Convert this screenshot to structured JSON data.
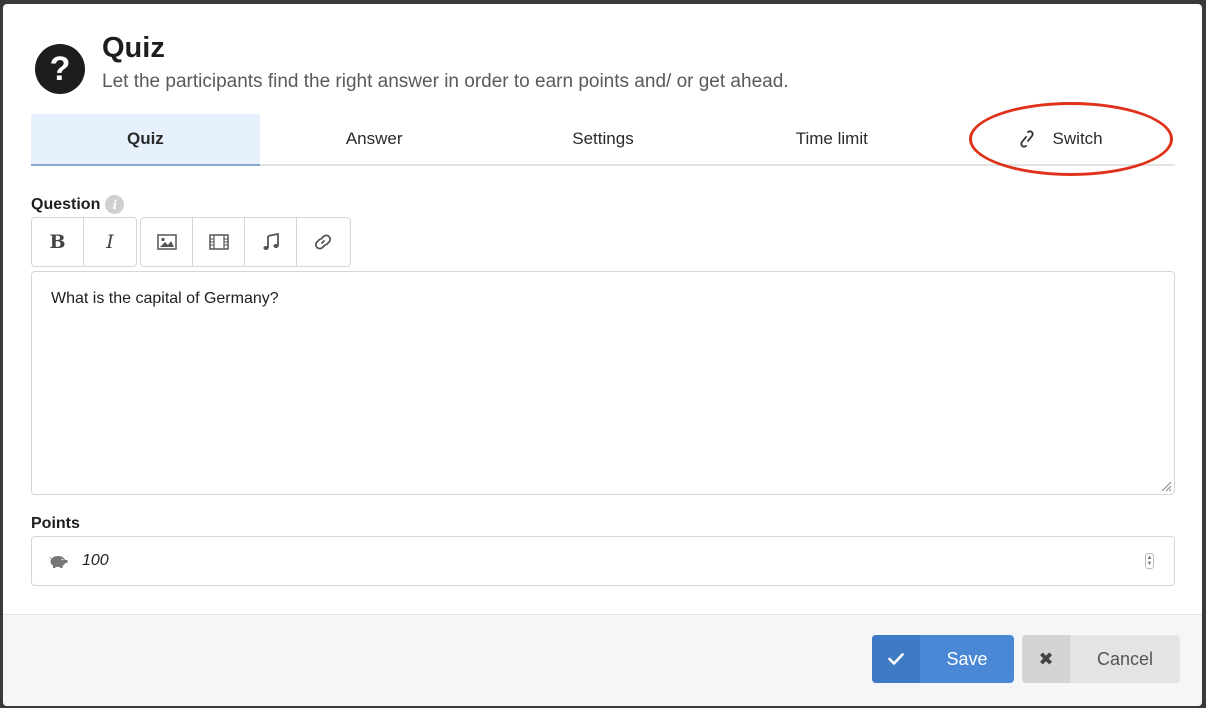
{
  "header": {
    "icon_glyph": "?",
    "title": "Quiz",
    "subtitle": "Let the participants find the right answer in order to earn points and/ or get ahead."
  },
  "tabs": [
    {
      "label": "Quiz",
      "active": true
    },
    {
      "label": "Answer",
      "active": false
    },
    {
      "label": "Settings",
      "active": false
    },
    {
      "label": "Time limit",
      "active": false
    },
    {
      "label": "Switch",
      "active": false,
      "icon": "link-icon"
    }
  ],
  "question": {
    "label": "Question",
    "info_glyph": "i",
    "toolbar": {
      "bold_label": "B",
      "italic_label": "I",
      "icons": [
        "image-icon",
        "film-icon",
        "music-icon",
        "link-icon"
      ]
    },
    "value": "What is the capital of Germany?"
  },
  "points": {
    "label": "Points",
    "icon": "piggy-bank-icon",
    "value": "100"
  },
  "footer": {
    "save_label": "Save",
    "save_icon": "check-icon",
    "cancel_label": "Cancel",
    "cancel_icon_glyph": "✖"
  },
  "colors": {
    "active_tab_bg": "#e6f1fd",
    "save_button": "#4a88d6",
    "highlight": "#e0321a"
  }
}
